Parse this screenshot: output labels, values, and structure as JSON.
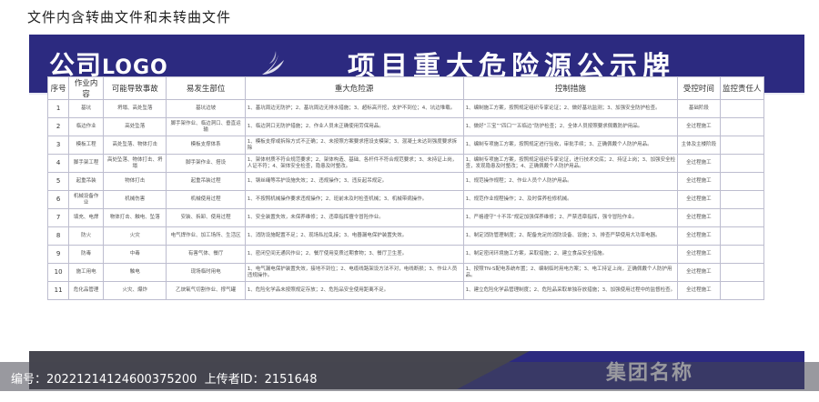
{
  "top_note": "文件内含转曲文件和未转曲文件",
  "header": {
    "logo_main": "公司",
    "logo_latin": "LOGO",
    "title": "项目重大危险源公示牌"
  },
  "table": {
    "columns": [
      "序号",
      "作业内容",
      "可能导致事故",
      "易发生部位",
      "重大危险源",
      "控制措施",
      "受控时间",
      "监控责任人"
    ],
    "rows": [
      [
        "1",
        "基坑",
        "坍塌、高处坠落",
        "基坑边坡",
        "1、基坑周边无防护；2、基坑周边无排水措施；3、超标高开挖，支护不到位；4、坑边堆载。",
        "1、编制施工方案，按照规定组织专家论证；2、做好基坑监测；3、加强安全防护检查。",
        "基础阶段",
        ""
      ],
      [
        "2",
        "临边作业",
        "高处坠落",
        "脚手架作业、临边洞口、垂直运输",
        "1、临边洞口无防护措施；2、作业人员未正确使用劳保用品。",
        "1、做好“三宝”“四口”“五临边”防护检查；2、全体人员按照要求佩戴防护用品。",
        "全过程施工",
        ""
      ],
      [
        "3",
        "模板工程",
        "高处坠落、物体打击",
        "模板支撑体系",
        "1、模板支撑或拆除方式不正确；2、未按照方案要求搭设支模架；3、混凝土未达到强度要求拆除",
        "1、编制专项施工方案，按照规定进行验收，审批手续；3、正确佩戴个人防护用品。",
        "主体及主楼阶段",
        ""
      ],
      [
        "4",
        "脚手架工程",
        "高处坠落、物体打击、坍塌",
        "脚手架作业、搭设",
        "1、架体材质不符合规范要求；2、架体构造、基础、各杆件不符合规范要求；3、未持证上岗，人证不符；4、架体安全检查，隐患及时整改。",
        "1、编制专项施工方案，按照规定组织专家论证，进行技术交底；2、持证上岗；3、加强安全检查，发现隐患及时整改；4、正确佩戴个人防护用品。",
        "全过程施工",
        ""
      ],
      [
        "5",
        "起重吊装",
        "物体打击",
        "起重吊装过程",
        "1、钢丝绳等吊护设施失效；2、违规操作；3、违反起吊规定。",
        "1、规范操作规程；2、作业人员个人防护用品。",
        "全过程施工",
        ""
      ],
      [
        "6",
        "机械设备作业",
        "机械伤害",
        "机械使用过程",
        "1、不按照机械操作要求违规操作；2、班前未及时检查机械；3、机械带病操作。",
        "1、规范作业规程操作；2、及时保养检修机械。",
        "全过程施工",
        ""
      ],
      [
        "7",
        "填充、电焊",
        "物体打击、触电、坠落",
        "安装、拆卸、使用过程",
        "1、安全装置失效，未保养维修；2、违章指挥擅令冒险作业。",
        "1、严格遵守“十不吊”规定加强保养维修；2、严禁违章指挥，强令冒险作业。",
        "全过程施工",
        ""
      ],
      [
        "8",
        "防火",
        "火灾",
        "电气焊作业、加工场所、生活区",
        "1、消防设施配置不足；2、现场私拉乱接；3、电器漏电保护装置失效。",
        "1、制定消防管理制度；2、配备充足的消防设备、设施；3、排查严禁使用大功率电器。",
        "全过程施工",
        ""
      ],
      [
        "9",
        "防毒",
        "中毒",
        "有害气体、餐厅",
        "1、密闭空间无通风作业；2、餐厅使用变质过期食物；3、餐厅卫生差。",
        "1、制定密闭环境施工方案，采取措施；2、建立食品安全措施。",
        "全过程施工",
        ""
      ],
      [
        "10",
        "施工用电",
        "触电",
        "现场临时用电",
        "1、电气漏电保护装置失效，接地不到位；2、电缆线路架设方法不对，电线断损；3、作业人员违规操作。",
        "1、按照TN-S配电系统布置；2、编制临时用电方案；3、电工持证上岗，正确佩戴个人防护用品。",
        "全过程施工",
        ""
      ],
      [
        "11",
        "危化品管理",
        "火灾、爆炸",
        "乙炔氧气切割作业、撑气罐",
        "1、危险化学品未按照规定存放；2、危险品安全使用距离不足。",
        "1、建立危险化学品管理制度；2、危险品采取单独存放措施；3、加强使用过程中的监督检查。",
        "全过程施工",
        ""
      ]
    ]
  },
  "footer": {
    "group_name": "集团名称"
  },
  "watermark": {
    "id_label": "编号：",
    "id_value": "20221214124600375200",
    "uploader_label": "上传者ID：",
    "uploader_value": "2151648"
  },
  "colors": {
    "brand_navy": "#2c2a80",
    "footer_gray": "#46464f"
  },
  "icons": {
    "emblem": "swoosh-bird-icon"
  }
}
